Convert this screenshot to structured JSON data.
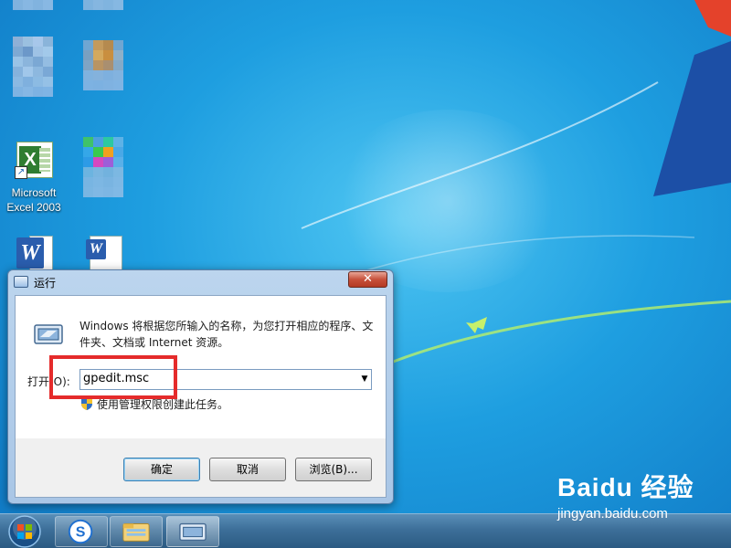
{
  "desktop": {
    "icons": [
      {
        "label": "Microsoft Excel 2003"
      }
    ]
  },
  "dialog": {
    "title": "运行",
    "close_glyph": "✕",
    "description": "Windows 将根据您所输入的名称，为您打开相应的程序、文件夹、文档或 Internet 资源。",
    "open_label": "打开(O):",
    "command_value": "gpedit.msc",
    "admin_note": "使用管理权限创建此任务。",
    "buttons": {
      "ok": "确定",
      "cancel": "取消",
      "browse": "浏览(B)..."
    },
    "highlight_color": "#e52b2b"
  },
  "taskbar": {
    "items": [
      "start-orb",
      "sogou-icon",
      "explorer-icon",
      "run-icon"
    ]
  },
  "watermark": {
    "logo": "Baidu 经验",
    "url": "jingyan.baidu.com"
  },
  "colors": {
    "desktop_bg": "#1e9ee0",
    "dialog_frame": "#a9c6e6",
    "close_button": "#c7503a"
  }
}
